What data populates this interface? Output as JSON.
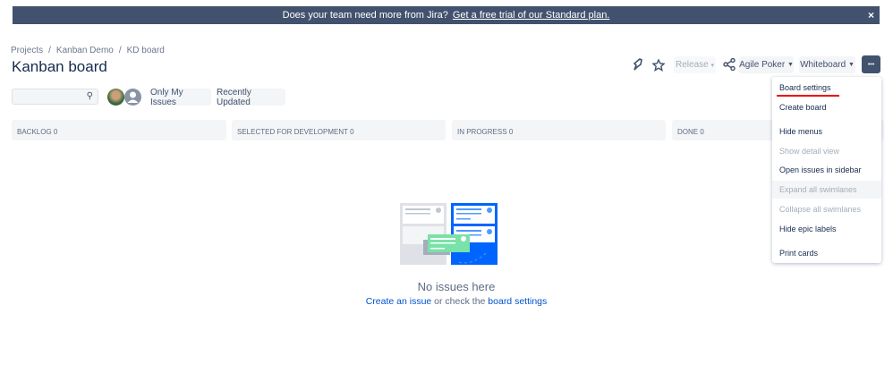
{
  "banner": {
    "text": "Does your team need more from Jira?",
    "link": "Get a free trial of our Standard plan.",
    "close": "×"
  },
  "breadcrumb": [
    "Projects",
    "Kanban Demo",
    "KD board"
  ],
  "title": "Kanban board",
  "toolbar": {
    "release": "Release",
    "agile_poker": "Agile Poker",
    "whiteboard": "Whiteboard",
    "more": "•••"
  },
  "filters": {
    "search_placeholder": "",
    "only_my_issues": "Only My Issues",
    "recently_updated": "Recently Updated"
  },
  "columns": [
    {
      "name": "Backlog",
      "count": "0"
    },
    {
      "name": "Selected for Development",
      "count": "0"
    },
    {
      "name": "In Progress",
      "count": "0"
    },
    {
      "name": "Done",
      "count": "0"
    }
  ],
  "menu": [
    {
      "label": "Board settings",
      "disabled": false
    },
    {
      "label": "Create board",
      "disabled": false
    },
    {
      "label": "Hide menus",
      "disabled": false
    },
    {
      "label": "Show detail view",
      "disabled": true
    },
    {
      "label": "Open issues in sidebar",
      "disabled": false
    },
    {
      "label": "Expand all swimlanes",
      "disabled": true
    },
    {
      "label": "Collapse all swimlanes",
      "disabled": true
    },
    {
      "label": "Hide epic labels",
      "disabled": false
    },
    {
      "label": "Print cards",
      "disabled": false
    }
  ],
  "empty": {
    "title": "No issues here",
    "create_link": "Create an issue",
    "middle": " or check the ",
    "settings_link": "board settings"
  }
}
